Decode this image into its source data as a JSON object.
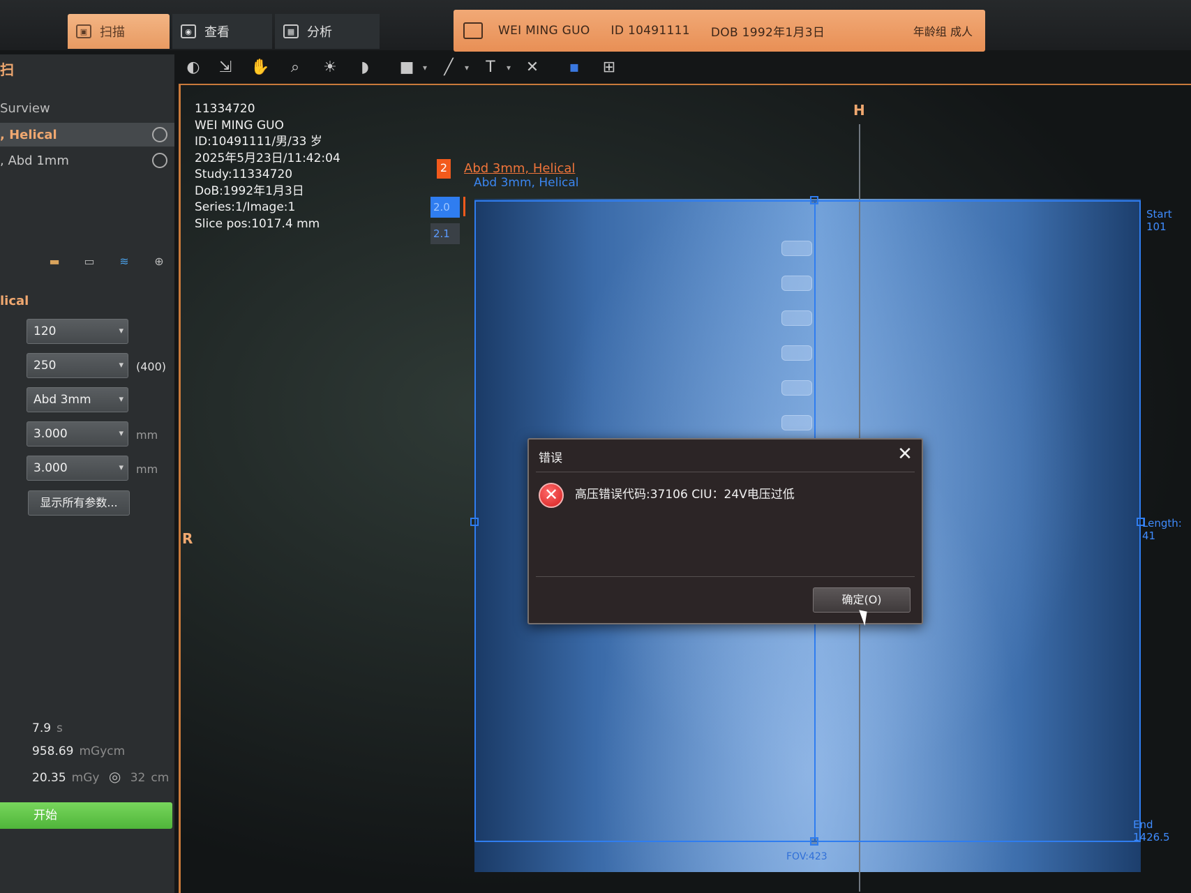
{
  "tabs": {
    "scan": "扫描",
    "view": "查看",
    "analysis": "分析"
  },
  "patient_banner": {
    "name": "WEI MING GUO",
    "id": "ID 10491111",
    "dob": "DOB 1992年1月3日",
    "age_group": "年龄组 成人"
  },
  "left_panel": {
    "title": "扫",
    "protocols": [
      {
        "label": "Surview"
      },
      {
        "label": ", Helical"
      },
      {
        "label": ", Abd 1mm"
      }
    ],
    "section_title": "lical",
    "params": [
      {
        "value": "120",
        "unit": ""
      },
      {
        "value": "250",
        "unit": "(400)"
      },
      {
        "value": "Abd 3mm",
        "unit": ""
      },
      {
        "value": "3.000",
        "unit": "mm"
      },
      {
        "value": "3.000",
        "unit": "mm"
      }
    ],
    "show_all_button": "显示所有参数...",
    "stats": {
      "time_value": "7.9",
      "time_unit": "s",
      "dlp_value": "958.69",
      "dlp_unit": "mGycm",
      "ctdi_value": "20.35",
      "ctdi_unit": "mGy",
      "phantom_value": "32",
      "phantom_unit": "cm"
    },
    "start_button": "开始"
  },
  "overlay_info": {
    "line1": "11334720",
    "line2": "WEI MING GUO",
    "line3": "ID:10491111/男/33 岁",
    "line4": "2025年5月23日/11:42:04",
    "line5": "Study:11334720",
    "line6": "DoB:1992年1月3日",
    "line7": "Series:1/Image:1",
    "line8": "Slice pos:1017.4 mm"
  },
  "viewport": {
    "label_h": "H",
    "label_r": "R",
    "series_number": "2",
    "series_name_active": "Abd 3mm, Helical",
    "series_name_secondary": "Abd 3mm, Helical",
    "recon_1": "2.0",
    "recon_2": "2.1",
    "start_label": "Start 101",
    "length_label": "Length: 41",
    "end_label": "End 1426.5",
    "fov_label": "FOV:423"
  },
  "dialog": {
    "title": "错误",
    "message": "高压错误代码:37106 CIU：24V电压过低",
    "ok_button": "确定(O)"
  }
}
